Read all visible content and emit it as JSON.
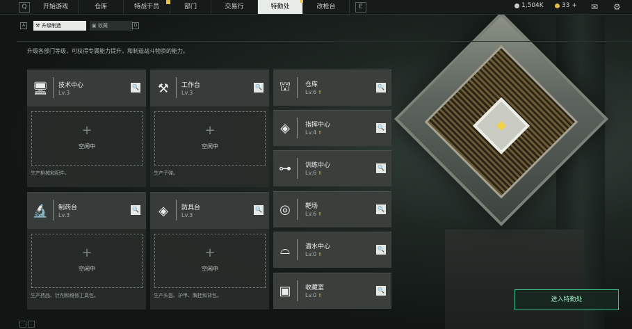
{
  "top_nav": {
    "tabs": [
      {
        "label": "开始游戏"
      },
      {
        "label": "仓库"
      },
      {
        "label": "特战干员"
      },
      {
        "label": "部门"
      },
      {
        "label": "交易行"
      },
      {
        "label": "特勤处"
      },
      {
        "label": "改枪台"
      }
    ],
    "active_tab": "特勤处",
    "left_edge_key": "Q",
    "right_edge_key": "E",
    "currency_silver": "1,504K",
    "currency_gold": "33",
    "currency_gold_add": "+",
    "colors": {
      "active_bg": "#e8ece9",
      "notif": "#e7c04b"
    }
  },
  "sub_tabs": {
    "items": [
      {
        "label": "升级制造",
        "icon": "upgrade-icon"
      },
      {
        "label": "收藏",
        "icon": "collection-icon"
      }
    ],
    "left_key": "A",
    "right_key": "D"
  },
  "description": "升级各部门等级，可获得专属能力提升，和制造战斗物资的能力。",
  "large_cards": [
    {
      "name": "技术中心",
      "level": "Lv.3",
      "icon": "monitor-icon",
      "slot_label": "空闲中",
      "desc": "生产枪械和配件。"
    },
    {
      "name": "工作台",
      "level": "Lv.3",
      "icon": "tools-icon",
      "slot_label": "空闲中",
      "desc": "生产子弹。"
    },
    {
      "name": "制药台",
      "level": "Lv.3",
      "icon": "microscope-icon",
      "slot_label": "空闲中",
      "desc": "生产药品、针剂和维修工具包。"
    },
    {
      "name": "防具台",
      "level": "Lv.3",
      "icon": "cubes-icon",
      "slot_label": "空闲中",
      "desc": "生产头盔、护甲、胸挂和背包。"
    }
  ],
  "small_cards": [
    {
      "name": "仓库",
      "level": "Lv.6",
      "icon": "warehouse-icon"
    },
    {
      "name": "指挥中心",
      "level": "Lv.4",
      "icon": "command-icon"
    },
    {
      "name": "训练中心",
      "level": "Lv.6",
      "icon": "dumbbell-icon"
    },
    {
      "name": "靶场",
      "level": "Lv.6",
      "icon": "target-icon"
    },
    {
      "name": "潜水中心",
      "level": "Lv.0",
      "icon": "goggles-icon"
    },
    {
      "name": "收藏室",
      "level": "Lv.0",
      "icon": "vault-icon"
    }
  ],
  "enter_button": "进入特勤处",
  "accent_color": "#3fc48a"
}
